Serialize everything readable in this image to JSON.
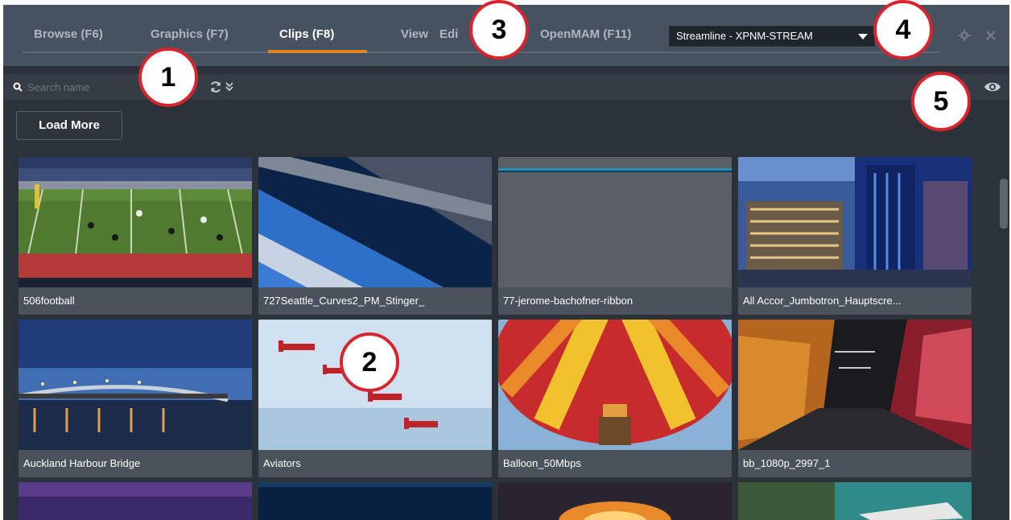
{
  "tabs": [
    {
      "label": "Browse (F6)",
      "active": false
    },
    {
      "label": "Graphics (F7)",
      "active": false
    },
    {
      "label": "Clips (F8)",
      "active": true
    },
    {
      "label": "View",
      "active": false
    },
    {
      "label": "Edi",
      "active": false
    },
    {
      "label": "OpenMAM (F11)",
      "active": false
    }
  ],
  "source_select": {
    "value": "Streamline - XPNM-STREAM"
  },
  "window_controls": {
    "settings_icon": "gear-icon",
    "close_icon": "close-icon"
  },
  "search": {
    "placeholder": "Search name",
    "value": ""
  },
  "toolbar": {
    "refresh_icon": "refresh-icon",
    "expand_icon": "chevron-double-down-icon",
    "visibility_icon": "eye-icon"
  },
  "load_more_label": "Load More",
  "clips": [
    {
      "name": "506football"
    },
    {
      "name": "727Seattle_Curves2_PM_Stinger_"
    },
    {
      "name": "77-jerome-bachofner-ribbon"
    },
    {
      "name": "All Accor_Jumbotron_Hauptscre..."
    },
    {
      "name": "Auckland Harbour Bridge"
    },
    {
      "name": "Aviators"
    },
    {
      "name": "Balloon_50Mbps"
    },
    {
      "name": "bb_1080p_2997_1"
    }
  ],
  "callouts": [
    "1",
    "2",
    "3",
    "4",
    "5"
  ],
  "colors": {
    "accent": "#e5822a",
    "callout_ring": "#d9242d",
    "panel_bg": "#2c323a",
    "tabbar_bg": "#465260"
  }
}
